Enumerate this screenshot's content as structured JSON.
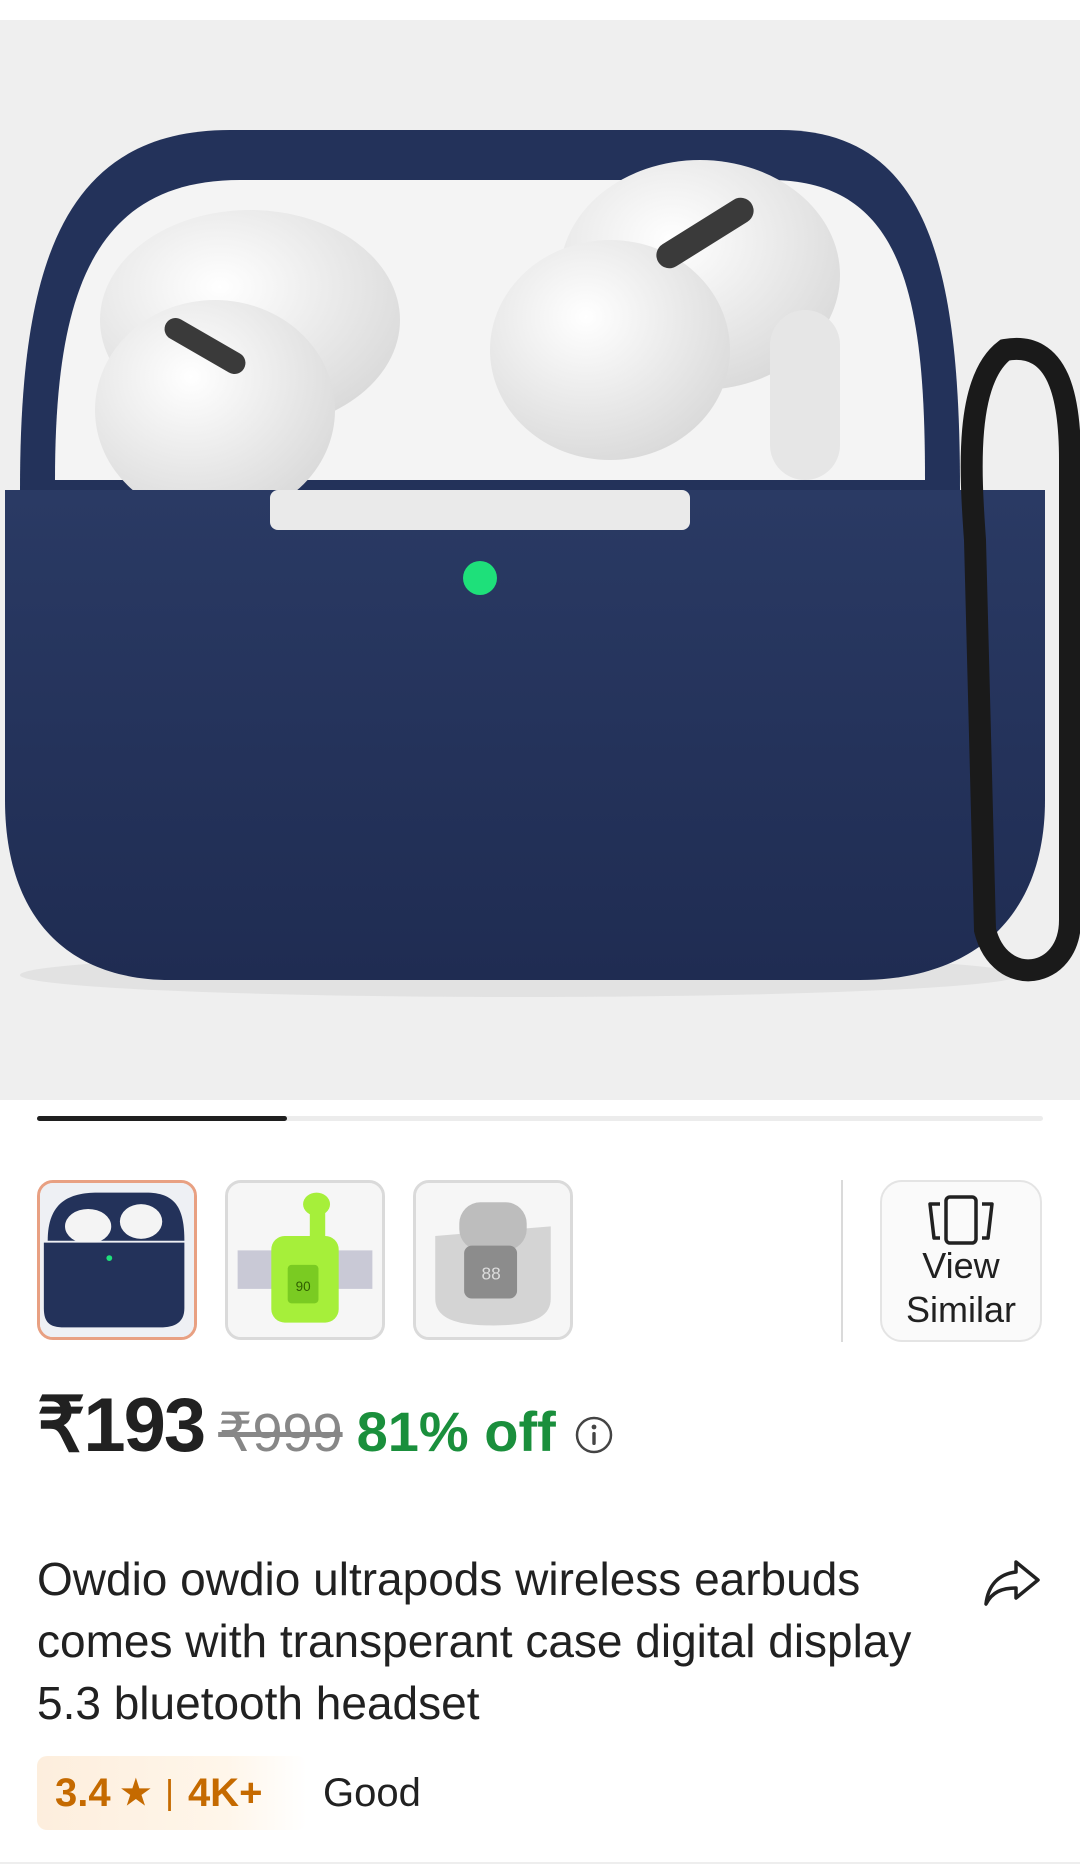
{
  "gallery": {
    "image_count_position": 0.25,
    "thumbnails": [
      {
        "name": "navy-case-earbuds",
        "selected": true
      },
      {
        "name": "green-transparent-earbuds",
        "selected": false
      },
      {
        "name": "grey-transparent-earbuds",
        "selected": false
      }
    ],
    "view_similar_label": "View\nSimilar"
  },
  "pricing": {
    "price": "₹193",
    "mrp": "₹999",
    "discount": "81% off"
  },
  "product": {
    "title": "Owdio owdio ultrapods wireless earbuds comes with transperant case digital display 5.3 bluetooth headset"
  },
  "rating": {
    "score": "3.4",
    "star": "★",
    "separator": "|",
    "count": "4K+",
    "label": "Good"
  },
  "colors": {
    "discount_green": "#1a8f3c",
    "rating_orange": "#c56a00",
    "case_navy": "#23325a",
    "selected_thumb_border": "#e8a082"
  }
}
